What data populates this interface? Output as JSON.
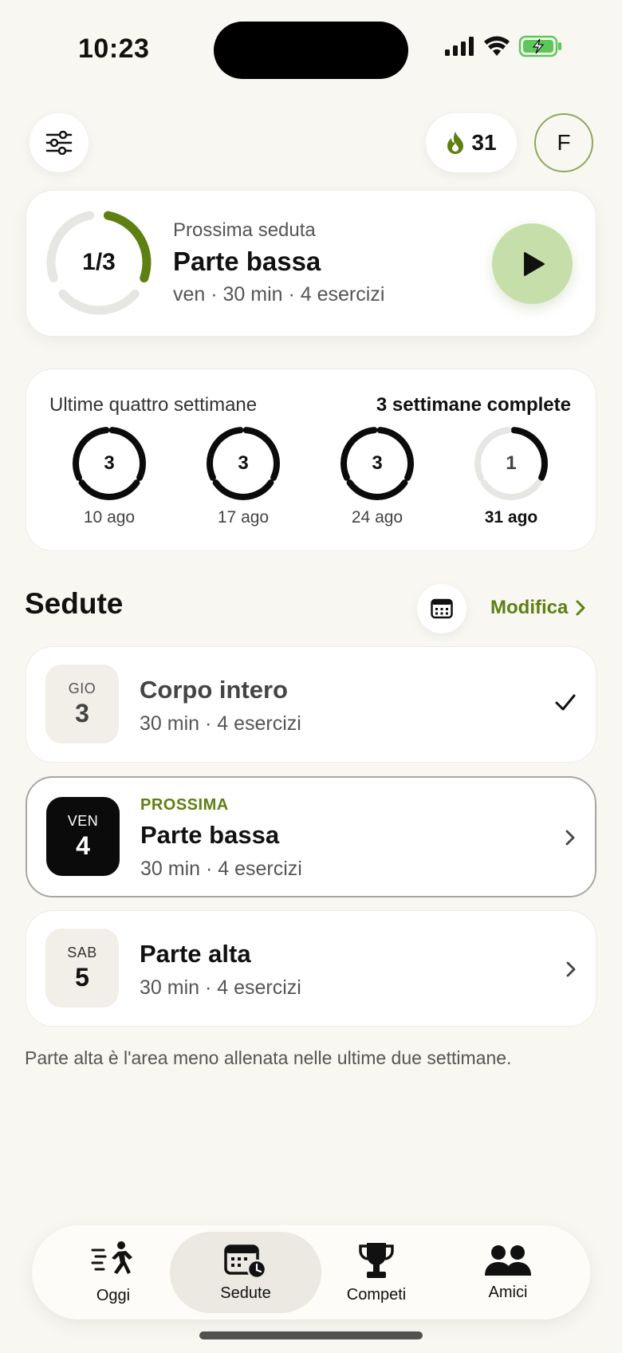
{
  "status_bar": {
    "time": "10:23"
  },
  "header": {
    "streak_count": "31",
    "avatar_initial": "F"
  },
  "next_session": {
    "progress_text": "1/3",
    "progress_fraction": 0.3333,
    "kicker": "Prossima seduta",
    "title": "Parte bassa",
    "meta": "ven · 30 min · 4 esercizi"
  },
  "weeks": {
    "title": "Ultime quattro settimane",
    "summary": "3 settimane complete",
    "items": [
      {
        "count": "3",
        "label": "10 ago",
        "fraction": 1,
        "bold": false
      },
      {
        "count": "3",
        "label": "17 ago",
        "fraction": 1,
        "bold": false
      },
      {
        "count": "3",
        "label": "24 ago",
        "fraction": 1,
        "bold": false
      },
      {
        "count": "1",
        "label": "31 ago",
        "fraction": 0.3333,
        "bold": true
      }
    ]
  },
  "sessions": {
    "title": "Sedute",
    "edit_label": "Modifica",
    "items": [
      {
        "dow": "GIO",
        "day": "3",
        "title": "Corpo intero",
        "meta": "30 min · 4 esercizi",
        "kicker": "",
        "status": "done"
      },
      {
        "dow": "VEN",
        "day": "4",
        "title": "Parte bassa",
        "meta": "30 min · 4 esercizi",
        "kicker": "PROSSIMA",
        "status": "next"
      },
      {
        "dow": "SAB",
        "day": "5",
        "title": "Parte alta",
        "meta": "30 min · 4 esercizi",
        "kicker": "",
        "status": "upcoming"
      }
    ],
    "hint": "Parte alta è l'area meno allenata nelle ultime due settimane."
  },
  "tabs": [
    {
      "label": "Oggi",
      "icon": "runner-icon",
      "active": false
    },
    {
      "label": "Sedute",
      "icon": "calendar-clock-icon",
      "active": true
    },
    {
      "label": "Competi",
      "icon": "trophy-icon",
      "active": false
    },
    {
      "label": "Amici",
      "icon": "people-icon",
      "active": false
    }
  ],
  "colors": {
    "accent": "#5e7f12",
    "ring_accent": "#5e7f12",
    "play_bg": "#c6dfaa",
    "background": "#f8f7f2"
  }
}
